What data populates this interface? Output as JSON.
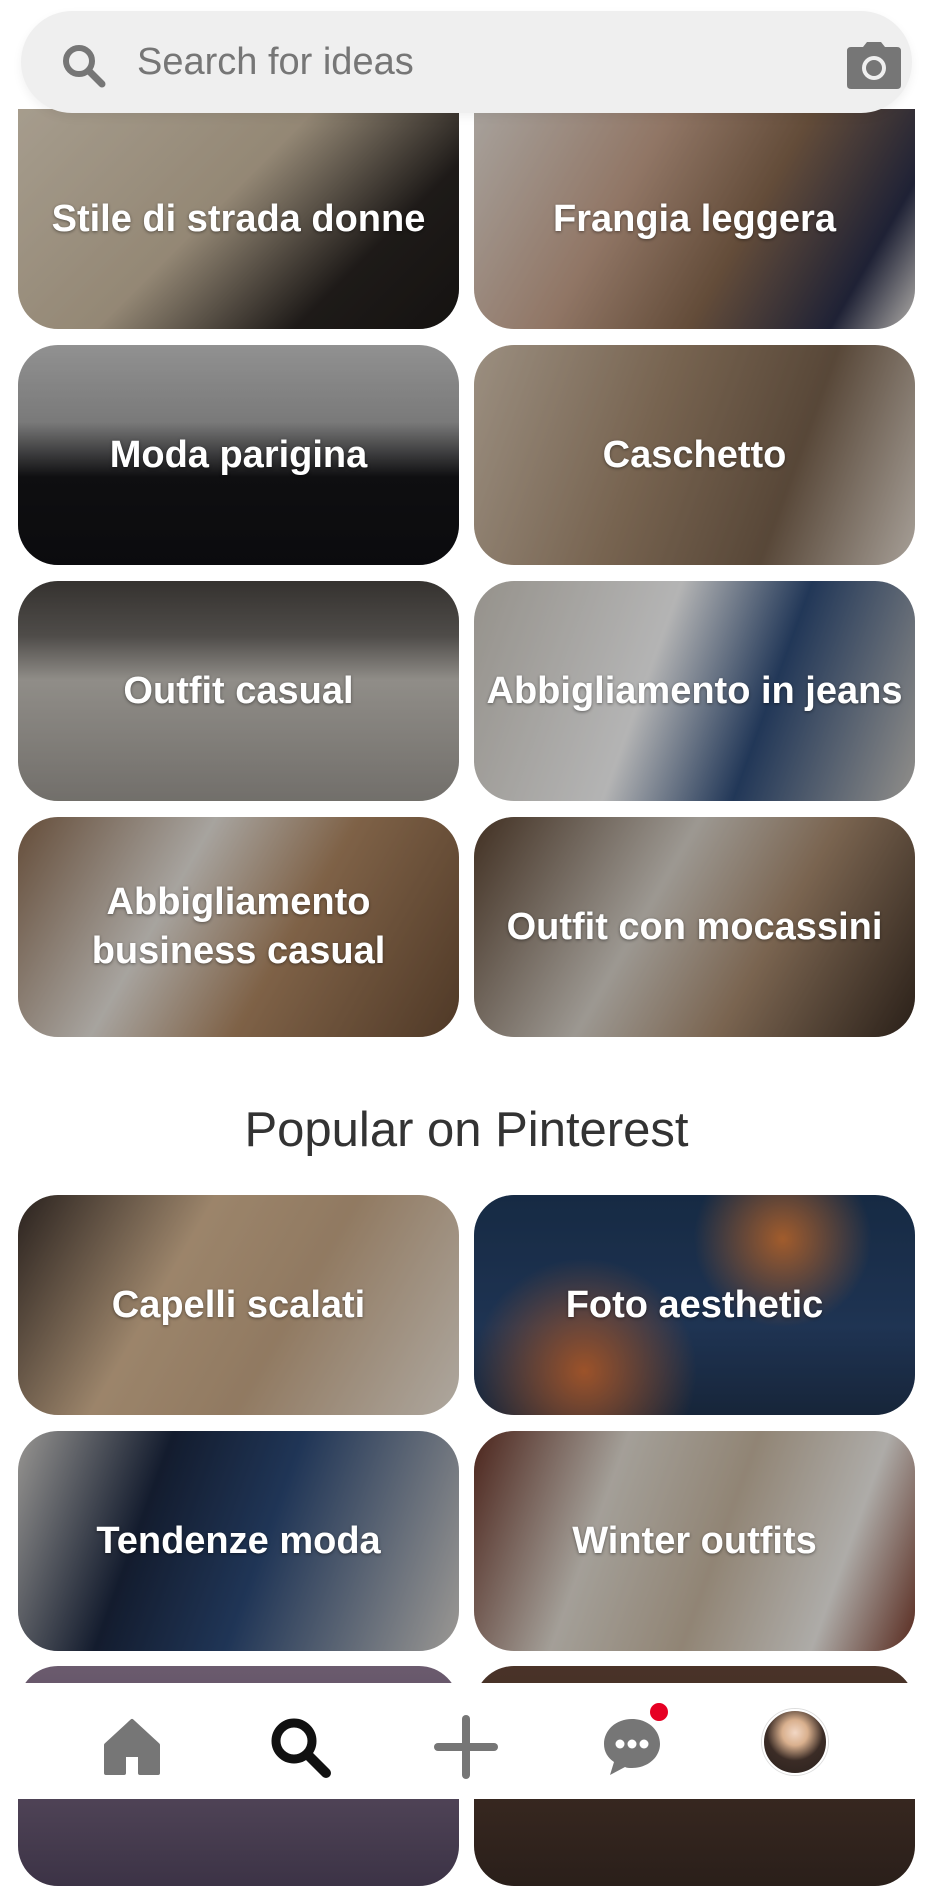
{
  "search": {
    "placeholder": "Search for ideas",
    "icons": [
      "search-icon",
      "camera-icon"
    ]
  },
  "ideas": [
    {
      "label": "Stile di strada donne"
    },
    {
      "label": "Frangia leggera"
    },
    {
      "label": "Moda parigina"
    },
    {
      "label": "Caschetto"
    },
    {
      "label": "Outfit casual"
    },
    {
      "label": "Abbigliamento in jeans"
    },
    {
      "label": "Abbigliamento business casual"
    },
    {
      "label": "Outfit con mocassini"
    }
  ],
  "popular": {
    "title": "Popular on Pinterest",
    "items": [
      {
        "label": "Capelli scalati"
      },
      {
        "label": "Foto aesthetic"
      },
      {
        "label": "Tendenze moda"
      },
      {
        "label": "Winter outfits"
      }
    ]
  },
  "bottom_nav": {
    "items": [
      "home-icon",
      "search-icon",
      "plus-icon",
      "chat-icon",
      "profile-avatar"
    ],
    "active": "search-icon",
    "colors": {
      "active": "#111111",
      "inactive": "#767676",
      "notification": "#e60023"
    }
  }
}
